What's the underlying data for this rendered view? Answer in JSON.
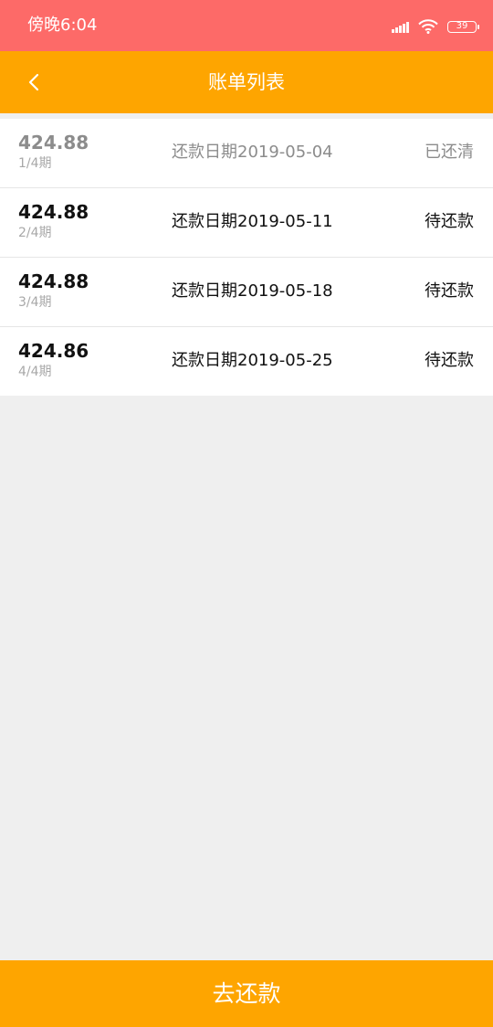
{
  "status_bar": {
    "time": "傍晚6:04",
    "battery": "39",
    "icons": [
      "signal-icon",
      "wifi-icon",
      "battery-icon"
    ],
    "color": "#fd6a68"
  },
  "nav": {
    "title": "账单列表",
    "back_icon": "chevron-left-icon",
    "color": "#fea500"
  },
  "bills": [
    {
      "amount": "424.88",
      "period": "1/4期",
      "date": "还款日期2019-05-04",
      "status": "已还清",
      "paid": true
    },
    {
      "amount": "424.88",
      "period": "2/4期",
      "date": "还款日期2019-05-11",
      "status": "待还款",
      "paid": false
    },
    {
      "amount": "424.88",
      "period": "3/4期",
      "date": "还款日期2019-05-18",
      "status": "待还款",
      "paid": false
    },
    {
      "amount": "424.86",
      "period": "4/4期",
      "date": "还款日期2019-05-25",
      "status": "待还款",
      "paid": false
    }
  ],
  "footer": {
    "pay_label": "去还款",
    "color": "#fea500"
  }
}
